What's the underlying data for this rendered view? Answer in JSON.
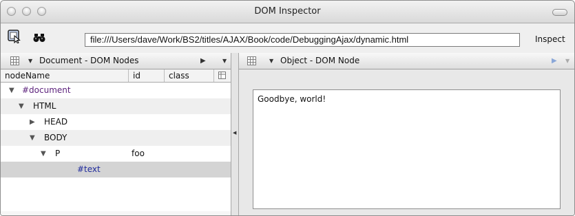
{
  "window": {
    "title": "DOM Inspector"
  },
  "toolbar": {
    "url": "file:///Users/dave/Work/BS2/titles/AJAX/Book/code/DebuggingAjax/dynamic.html",
    "inspect_label": "Inspect"
  },
  "left_panel": {
    "title": "Document - DOM Nodes",
    "columns": [
      "nodeName",
      "id",
      "class"
    ],
    "rows": [
      {
        "name": "#document",
        "id": "",
        "indent": 0,
        "twisty": "open",
        "color": "#5a1f7a"
      },
      {
        "name": "HTML",
        "id": "",
        "indent": 1,
        "twisty": "open",
        "color": "#111111"
      },
      {
        "name": "HEAD",
        "id": "",
        "indent": 2,
        "twisty": "closed",
        "color": "#111111"
      },
      {
        "name": "BODY",
        "id": "",
        "indent": 2,
        "twisty": "open",
        "color": "#111111"
      },
      {
        "name": "P",
        "id": "foo",
        "indent": 3,
        "twisty": "open",
        "color": "#111111"
      },
      {
        "name": "#text",
        "id": "",
        "indent": 4,
        "twisty": "none",
        "color": "#1f2a9c"
      }
    ]
  },
  "right_panel": {
    "title": "Object - DOM Node",
    "text_value": "Goodbye, world!"
  },
  "icons": {
    "inspect_element": "inspect-pointer-icon",
    "search": "binoculars-icon",
    "grid": "grid-icon"
  },
  "colors": {
    "selected_row": "#d4d4d4",
    "document_text": "#5a1f7a",
    "text_node": "#1f2a9c"
  }
}
